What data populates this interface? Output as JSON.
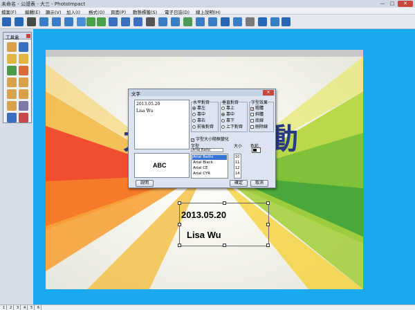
{
  "window": {
    "title": "未命名 - 公證表 - 大三 - PhotoImpact",
    "controls": {
      "minimize": "—",
      "maximize": "□",
      "close": "✕"
    }
  },
  "menubar": {
    "items": [
      "檔案(F)",
      "編輯(E)",
      "顯示(V)",
      "加入(I)",
      "格式(O)",
      "頁面(P)",
      "動態標籤(S)",
      "電子日誌(D)",
      "線上說明(H)"
    ]
  },
  "toolbar": {
    "buttons": [
      {
        "icon": "home-icon",
        "color": "#2a66b8"
      },
      {
        "icon": "save-icon",
        "color": "#2a66b8"
      },
      {
        "icon": "print-icon",
        "color": "#4a4a4a"
      },
      {
        "icon": "scan-icon",
        "color": "#3b7ec8"
      },
      {
        "icon": "photo-icon",
        "color": "#3b7ec8"
      },
      {
        "icon": "page-icon",
        "color": "#3b7ec8"
      },
      {
        "icon": "slide-icon",
        "color": "#4b8fd6"
      },
      {
        "icon": "prev-page-icon",
        "color": "#4aa04a"
      },
      {
        "icon": "next-page-icon",
        "color": "#4aa04a"
      },
      {
        "icon": "undo-icon",
        "color": "#3b6fc0"
      },
      {
        "icon": "redo-icon",
        "color": "#3b6fc0"
      },
      {
        "icon": "rotate-icon",
        "color": "#3b6fc0"
      },
      {
        "icon": "zoom-icon",
        "color": "#555555"
      },
      {
        "icon": "text-icon",
        "color": "#3b7ec8"
      },
      {
        "icon": "table-icon",
        "color": "#3b7ec8"
      },
      {
        "icon": "audio-icon",
        "color": "#4a9a5a"
      },
      {
        "icon": "folder-icon",
        "color": "#3b7ec8"
      },
      {
        "icon": "mail-icon",
        "color": "#3b7ec8"
      },
      {
        "icon": "share-icon",
        "color": "#2a66b8"
      },
      {
        "icon": "clip-icon",
        "color": "#3b7ec8"
      },
      {
        "icon": "calendar-icon",
        "color": "#7a7a7a"
      },
      {
        "icon": "help-icon",
        "color": "#2a66b8"
      },
      {
        "icon": "monitor-icon",
        "color": "#3b7ec8"
      },
      {
        "icon": "play-icon",
        "color": "#2a66b8"
      }
    ]
  },
  "tool_panel": {
    "title": "工具盒",
    "tools": [
      {
        "icon": "select-tool-icon",
        "color": "#d9a24a"
      },
      {
        "icon": "magic-wand-icon",
        "color": "#3b6fc0"
      },
      {
        "icon": "pencil-icon",
        "color": "#e0b640"
      },
      {
        "icon": "ellipse-icon",
        "color": "#e0b640"
      },
      {
        "icon": "brush-icon",
        "color": "#4a9a4a"
      },
      {
        "icon": "shape-icon",
        "color": "#d96d3a"
      },
      {
        "icon": "copy-icon",
        "color": "#d9a24a"
      },
      {
        "icon": "paste-icon",
        "color": "#d9a24a"
      },
      {
        "icon": "stamp-icon",
        "color": "#d9a24a"
      },
      {
        "icon": "crop-icon",
        "color": "#d9a24a"
      },
      {
        "icon": "texture-icon",
        "color": "#d9a24a"
      },
      {
        "icon": "grid-icon",
        "color": "#7a7aa8"
      },
      {
        "icon": "layer-icon",
        "color": "#3b6fc0"
      },
      {
        "icon": "effect-icon",
        "color": "#c84a4a"
      }
    ]
  },
  "slide": {
    "title_left": "大",
    "title_right": "動",
    "textbox_line1": "2013.05.20",
    "textbox_line2": "Lisa Wu"
  },
  "dialog": {
    "title": "文字",
    "close": "✕",
    "text_line1": "2013.05.20",
    "text_line2": "Lisa Wu",
    "preview": "ABC",
    "horizontal_align": {
      "title": "水平對齊",
      "options": [
        "靠左",
        "靠中",
        "靠右",
        "前後對齊"
      ],
      "selected": 0
    },
    "vertical_align": {
      "title": "垂直對齊",
      "options": [
        "靠上",
        "靠中",
        "靠下",
        "上下對齊"
      ],
      "selected": 1
    },
    "font_effect": {
      "title": "字型效果",
      "options": [
        "粗體",
        "斜體",
        "底線",
        "刪除線"
      ],
      "checked": [
        true,
        false,
        false,
        false
      ]
    },
    "auto_size_label": "字型大小隨框變化",
    "font_label": "字型",
    "font_value": "Arial Baltic",
    "font_list": [
      "Arial Baltic",
      "Arial Black",
      "Arial CE",
      "Arial CYR"
    ],
    "font_selected": 0,
    "size_label": "大小",
    "size_list": [
      "10",
      "11",
      "12",
      "14"
    ],
    "color_label": "色彩",
    "help_button": "說明",
    "ok_button": "確定",
    "cancel_button": "取消"
  },
  "statusbar": {
    "tabs": [
      "1",
      "2",
      "3",
      "4",
      "5",
      "6"
    ]
  },
  "colors": {
    "canvas_bg": "#1aa9ee",
    "title_text": "#2a3a82",
    "dialog_bg": "#dbe4f0",
    "close_red": "#c9463d"
  }
}
